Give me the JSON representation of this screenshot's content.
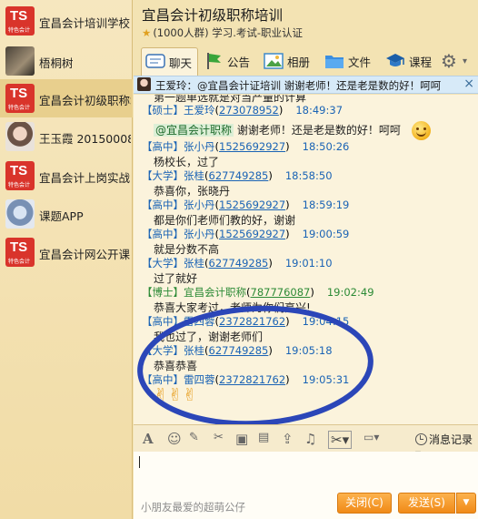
{
  "sidebar": {
    "items": [
      {
        "name": "宜昌会计培训学校",
        "avatar": "ts",
        "active": false
      },
      {
        "name": "梧桐树",
        "avatar": "photo1",
        "active": false
      },
      {
        "name": "宜昌会计初级职称培训",
        "avatar": "ts",
        "active": true
      },
      {
        "name": "王玉霞 20150008",
        "avatar": "photo2",
        "active": false
      },
      {
        "name": "宜昌会计上岗实战",
        "avatar": "ts",
        "active": false
      },
      {
        "name": "课题APP",
        "avatar": "photo3",
        "active": false
      },
      {
        "name": "宜昌会计网公开课",
        "avatar": "ts",
        "active": false
      }
    ],
    "ts_logo_text": "TS",
    "ts_logo_sub": "特色会计"
  },
  "header": {
    "title": "宜昌会计初级职称培训",
    "subtitle": "(1000人群) 学习.考试-职业认证"
  },
  "toolbar": {
    "tabs": [
      "聊天",
      "公告",
      "相册",
      "文件",
      "课程"
    ]
  },
  "notice": {
    "text": "王爱玲：@宜昌会计证培训 谢谢老师！还是老是数的好！呵呵",
    "close": "×"
  },
  "chat": {
    "partial_text": "第一题单选就是对当产量的计算",
    "messages": [
      {
        "level": "【硕士】",
        "name": "王爱玲",
        "qq": "273078952",
        "time": "18:49:37",
        "mention": "@宜昌会计职称",
        "text": "谢谢老师！还是老是数的好！呵呵",
        "emoji": "smile-emoji"
      },
      {
        "level": "【高中】",
        "name": "张小丹",
        "qq": "1525692927",
        "time": "18:50:26",
        "text": "杨校长，过了"
      },
      {
        "level": "【大学】",
        "name": "张桂",
        "qq": "627749285",
        "time": "18:58:50",
        "text": "恭喜你，张晓丹"
      },
      {
        "level": "【高中】",
        "name": "张小丹",
        "qq": "1525692927",
        "time": "18:59:19",
        "text": "都是你们老师们教的好，谢谢"
      },
      {
        "level": "【高中】",
        "name": "张小丹",
        "qq": "1525692927",
        "time": "19:00:59",
        "text": "就是分数不高"
      },
      {
        "level": "【大学】",
        "name": "张桂",
        "qq": "627749285",
        "time": "19:01:10",
        "text": "过了就好"
      },
      {
        "level": "【博士】",
        "name": "宜昌会计职称",
        "qq": "787776087",
        "time": "19:02:49",
        "text": "恭喜大家考过，老师为你们高兴!",
        "green": true
      },
      {
        "level": "【高中】",
        "name": "雷四蓉",
        "qq": "2372821762",
        "time": "19:04:15",
        "text": "我也过了，谢谢老师们"
      },
      {
        "level": "【大学】",
        "name": "张桂",
        "qq": "627749285",
        "time": "19:05:18",
        "text": "恭喜恭喜"
      },
      {
        "level": "【高中】",
        "name": "雷四蓉",
        "qq": "2372821762",
        "time": "19:05:31",
        "text": "✌✌✌"
      }
    ]
  },
  "input": {
    "message_record": "消息记录",
    "signature": "小朋友最爱的超萌公仔"
  },
  "buttons": {
    "close": "关闭(C)",
    "send": "发送(S)"
  },
  "colors": {
    "annotation_ellipse": "#2b46b8",
    "button_orange": "#f39a2a",
    "link_blue": "#1a63b5"
  }
}
